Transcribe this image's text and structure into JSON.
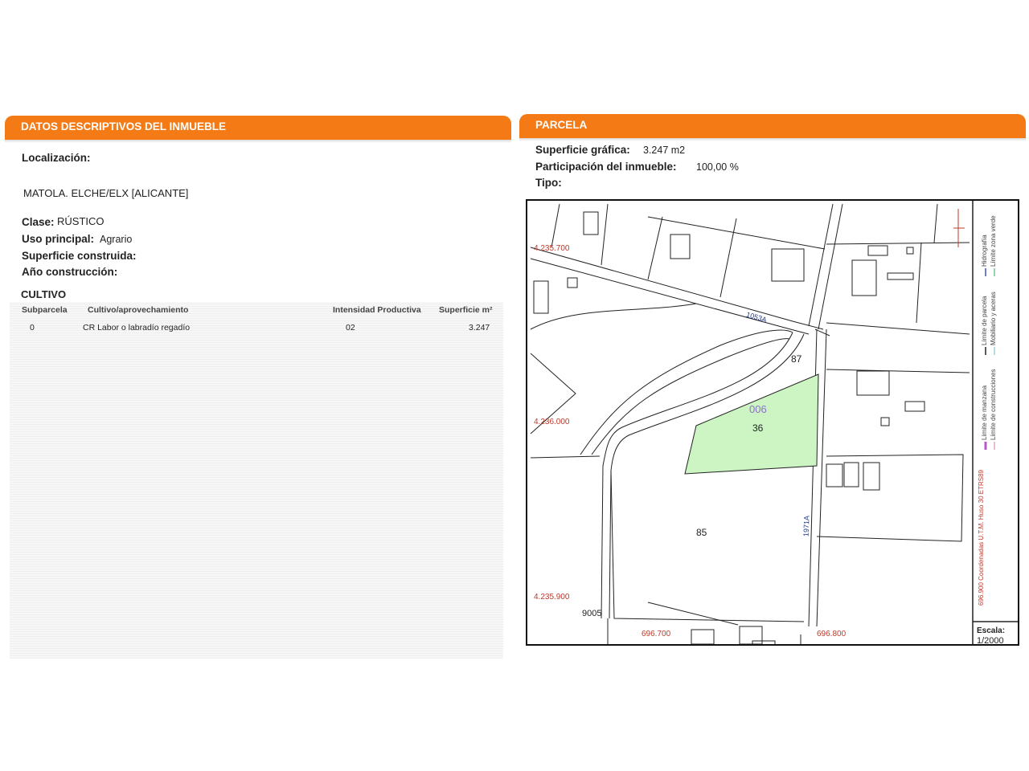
{
  "left_panel": {
    "title": "DATOS DESCRIPTIVOS DEL INMUEBLE",
    "localizacion_label": "Localización:",
    "localizacion_value": "MATOLA. ELCHE/ELX [ALICANTE]",
    "clase_label": "Clase:",
    "clase_value": "RÚSTICO",
    "uso_label": "Uso principal:",
    "uso_value": "Agrario",
    "superficie_label": "Superficie construida:",
    "anio_label": "Año construcción:",
    "cultivo_title": "CULTIVO",
    "table": {
      "headers": [
        "Subparcela",
        "Cultivo/aprovechamiento",
        "Intensidad Productiva",
        "Superficie m²"
      ],
      "rows": [
        [
          "0",
          "CR Labor o labradío regadío",
          "02",
          "3.247"
        ]
      ]
    }
  },
  "right_panel": {
    "title": "PARCELA",
    "superficie_grafica_label": "Superficie gráfica:",
    "superficie_grafica_value": "3.247 m2",
    "participacion_label": "Participación del inmueble:",
    "participacion_value": "100,00 %",
    "tipo_label": "Tipo:",
    "map": {
      "parcel_code": "006",
      "parcel_number": "36",
      "neighbor_87": "87",
      "neighbor_85": "85",
      "neighbor_9005": "9005",
      "road_1": "1053A",
      "road_2": "1971A",
      "coord_y_1": "4.235.700",
      "coord_y_2": "4.236.000",
      "coord_y_3": "4.235.900",
      "coord_x_1": "696.700",
      "coord_x_2": "696.800",
      "projection_note": "696.900 Coordenadas U.T.M. Huso 30 ETRS89",
      "legend": {
        "limite_manzana": "Límite de manzana",
        "limite_construcciones": "Límite de construcciones",
        "limite_parcela": "Límite de parcela",
        "mobiliario": "Mobiliario y aceras",
        "hidrografia": "Hidrografía",
        "limite_zona_verde": "Límite zona verde"
      },
      "escala_label": "Escala:",
      "escala_value": "1/2000",
      "colors": {
        "parcel_fill": "#cdf5c4",
        "coord_red": "#c0392b",
        "code_purple": "#8a6fcf",
        "road_blue": "#1f3b8f"
      }
    }
  }
}
